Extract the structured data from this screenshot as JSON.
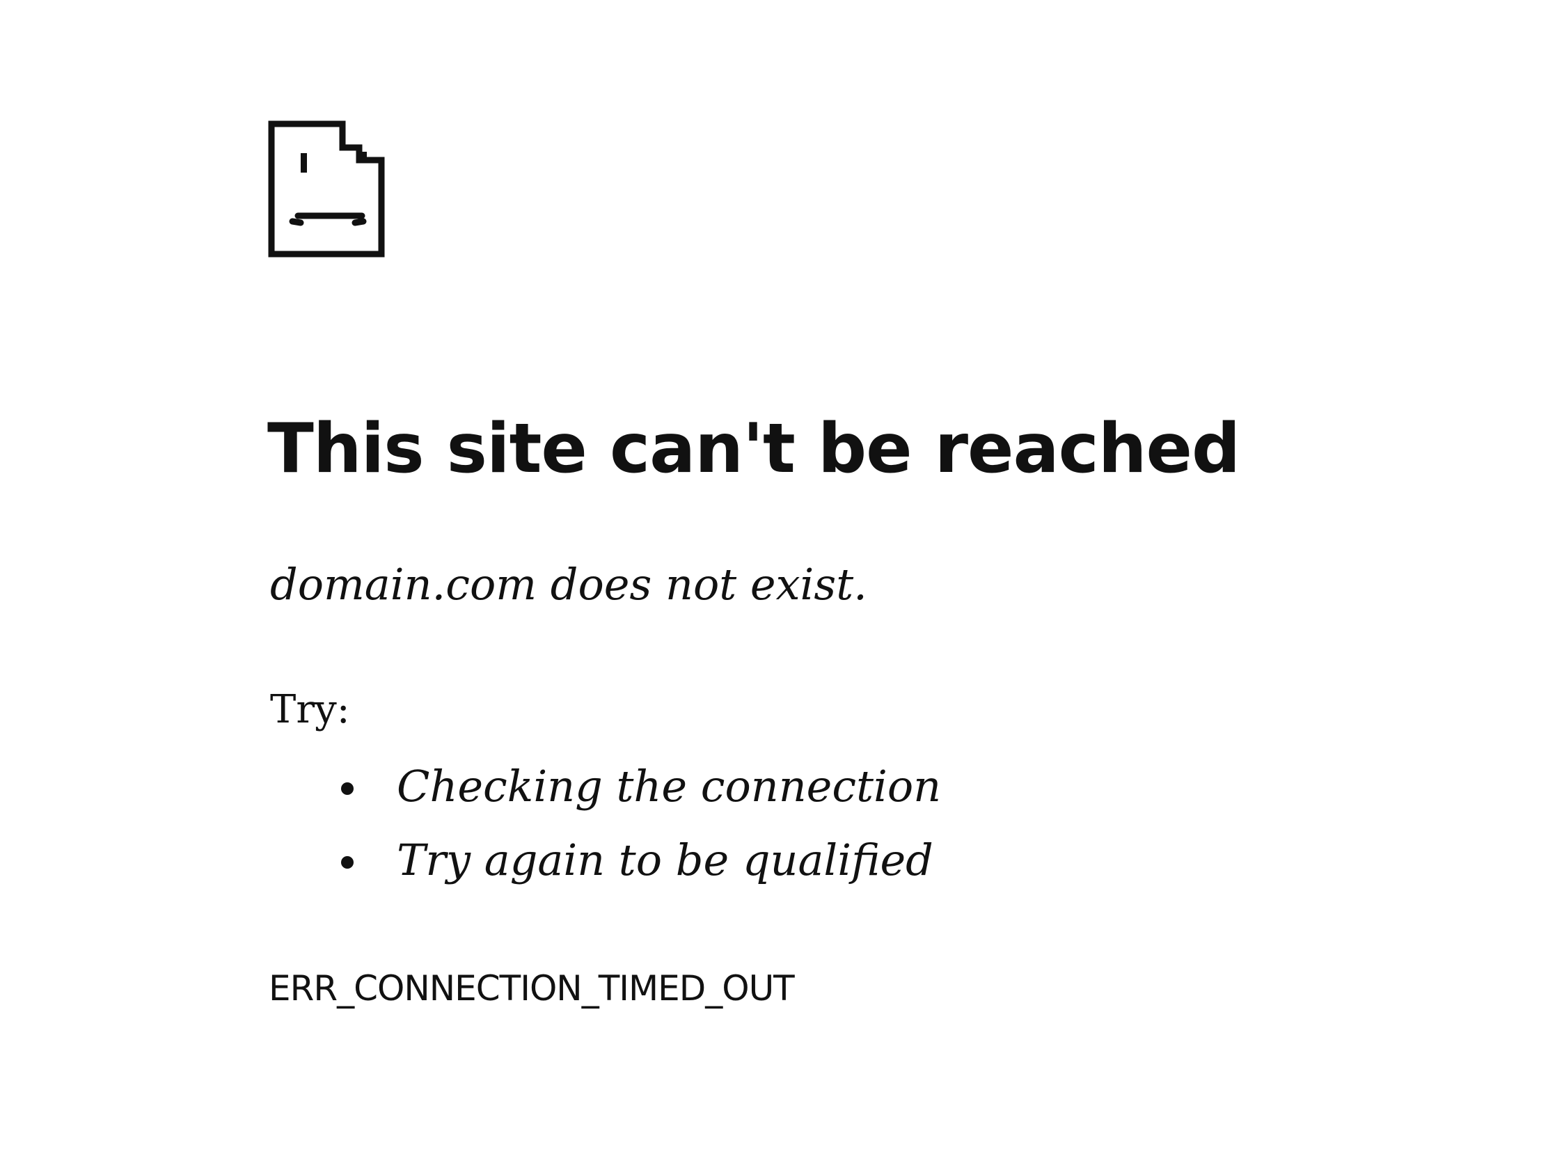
{
  "icon": "sad-document-icon",
  "error": {
    "title": "This site can't be reached",
    "message": "domain.com does not exist.",
    "try_label": "Try:",
    "suggestions": [
      "Checking the connection",
      "Try again to be qualified"
    ],
    "code": "ERR_CONNECTION_TIMED_OUT"
  }
}
